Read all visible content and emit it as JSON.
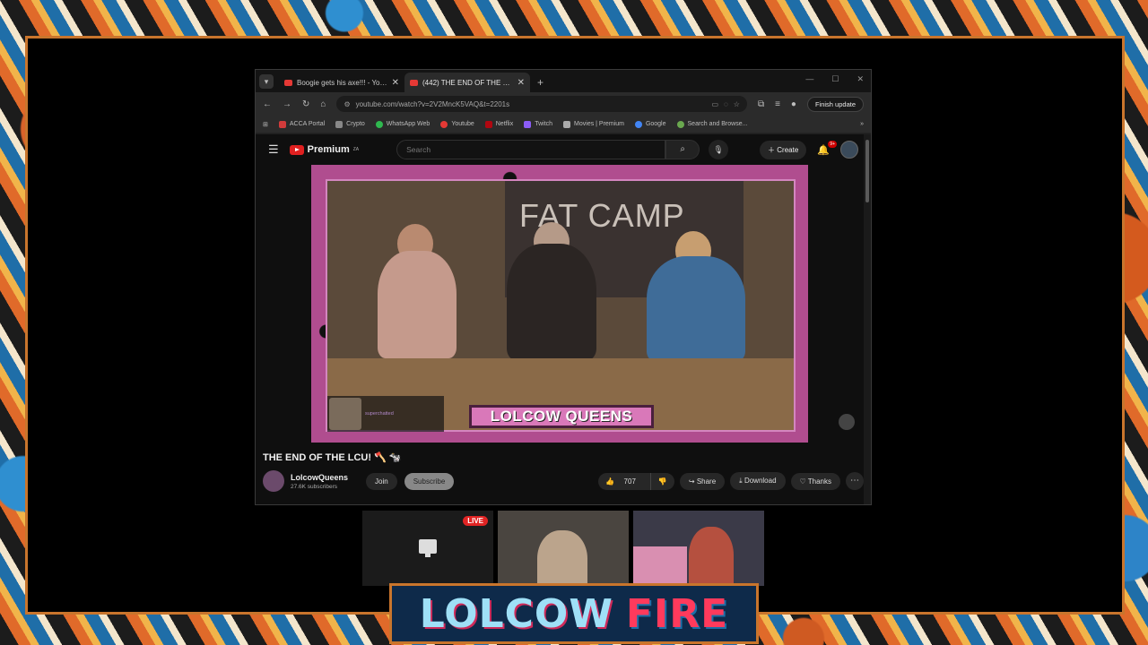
{
  "browser": {
    "tabs": [
      {
        "title": "Boogie gets his axe!!! - YouTube",
        "active": false
      },
      {
        "title": "(442) THE END OF THE LCU!",
        "active": true
      }
    ],
    "url": "youtube.com/watch?v=2V2MncK5VAQ&t=2201s",
    "finish_update": "Finish update",
    "bookmarks": [
      {
        "label": "ACCA Portal",
        "color": "#d13b3b"
      },
      {
        "label": "Crypto",
        "color": "#888888"
      },
      {
        "label": "WhatsApp Web",
        "color": "#2fb84f"
      },
      {
        "label": "Youtube",
        "color": "#e53935"
      },
      {
        "label": "Netflix",
        "color": "#b00710"
      },
      {
        "label": "Twitch",
        "color": "#8b5cf6"
      },
      {
        "label": "Movies | Premium",
        "color": "#aaaaaa"
      },
      {
        "label": "Google",
        "color": "#4285f4"
      },
      {
        "label": "Search and Browse...",
        "color": "#6aa84f"
      }
    ]
  },
  "youtube": {
    "logo": "Premium",
    "logo_region": "ZA",
    "search_placeholder": "Search",
    "create_label": "Create",
    "notif_badge": "9+",
    "video": {
      "banner_text": "FAT CAMP",
      "lower_third": "LOLCOW QUEENS",
      "super_user": "",
      "super_text": "superchatted"
    },
    "title": "THE END OF THE LCU! 🪓 🐄",
    "channel": {
      "name": "LolcowQueens",
      "subscribers": "27.6K subscribers",
      "join": "Join",
      "subscribe": "Subscribe"
    },
    "actions": {
      "likes": "707",
      "share": "Share",
      "download": "Download",
      "thanks": "Thanks"
    }
  },
  "stream": {
    "live_badge": "LIVE",
    "brand_part1": "LOLCOW",
    "brand_part2": "FIRE"
  }
}
